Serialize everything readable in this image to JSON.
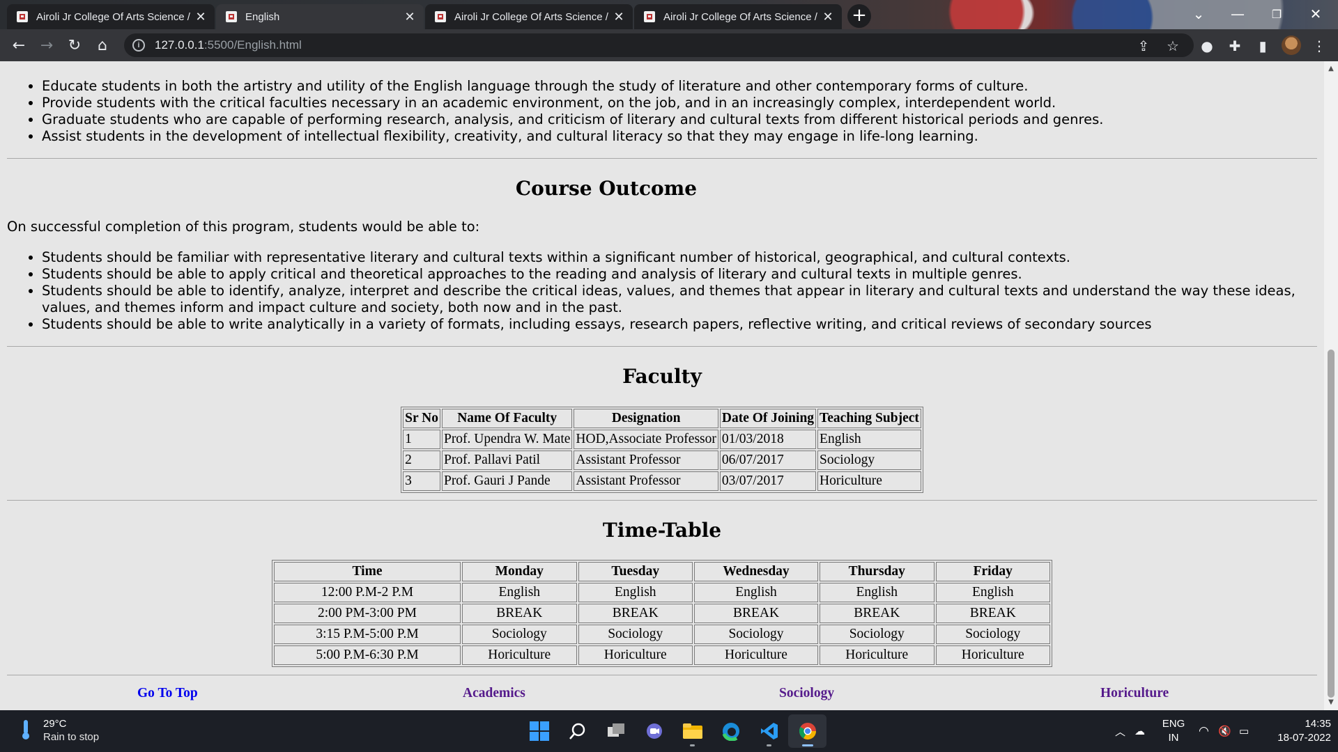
{
  "browser": {
    "tabs": [
      {
        "title": "Airoli Jr College Of Arts Science /",
        "active": false
      },
      {
        "title": "English",
        "active": true
      },
      {
        "title": "Airoli Jr College Of Arts Science /",
        "active": false
      },
      {
        "title": "Airoli Jr College Of Arts Science /",
        "active": false
      }
    ],
    "address": {
      "host": "127.0.0.1",
      "path": ":5500/English.html"
    },
    "close_glyph": "✕",
    "new_tab_glyph": "+"
  },
  "objectives": [
    "Educate students in both the artistry and utility of the English language through the study of literature and other contemporary forms of culture.",
    "Provide students with the critical faculties necessary in an academic environment, on the job, and in an increasingly complex, interdependent world.",
    "Graduate students who are capable of performing research, analysis, and criticism of literary and cultural texts from different historical periods and genres.",
    "Assist students in the development of intellectual flexibility, creativity, and cultural literacy so that they may engage in life-long learning."
  ],
  "course_outcome": {
    "heading": "Course Outcome",
    "intro": "On successful completion of this program, students would be able to:",
    "items": [
      "Students should be familiar with representative literary and cultural texts within a significant number of historical, geographical, and cultural contexts.",
      "Students should be able to apply critical and theoretical approaches to the reading and analysis of literary and cultural texts in multiple genres.",
      "Students should be able to identify, analyze, interpret and describe the critical ideas, values, and themes that appear in literary and cultural texts and understand the way these ideas, values, and themes inform and impact culture and society, both now and in the past.",
      "Students should be able to write analytically in a variety of formats, including essays, research papers, reflective writing, and critical reviews of secondary sources"
    ]
  },
  "faculty": {
    "heading": "Faculty",
    "columns": [
      "Sr No",
      "Name Of Faculty",
      "Designation",
      "Date Of Joining",
      "Teaching Subject"
    ],
    "rows": [
      [
        "1",
        "Prof. Upendra W. Mate",
        "HOD,Associate Professor",
        "01/03/2018",
        "English"
      ],
      [
        "2",
        "Prof. Pallavi Patil",
        "Assistant Professor",
        "06/07/2017",
        "Sociology"
      ],
      [
        "3",
        "Prof. Gauri J Pande",
        "Assistant Professor",
        "03/07/2017",
        "Horiculture"
      ]
    ]
  },
  "timetable": {
    "heading": "Time-Table",
    "columns": [
      "Time",
      "Monday",
      "Tuesday",
      "Wednesday",
      "Thursday",
      "Friday"
    ],
    "rows": [
      [
        "12:00 P.M-2 P.M",
        "English",
        "English",
        "English",
        "English",
        "English"
      ],
      [
        "2:00 PM-3:00 PM",
        "BREAK",
        "BREAK",
        "BREAK",
        "BREAK",
        "BREAK"
      ],
      [
        "3:15 P.M-5:00 P.M",
        "Sociology",
        "Sociology",
        "Sociology",
        "Sociology",
        "Sociology"
      ],
      [
        "5:00 P.M-6:30 P.M",
        "Horiculture",
        "Horiculture",
        "Horiculture",
        "Horiculture",
        "Horiculture"
      ]
    ]
  },
  "footer_links": {
    "go_to_top": "Go To Top",
    "academics": "Academics",
    "sociology": "Sociology",
    "horiculture": "Horiculture"
  },
  "colors": {
    "link": "#0000ee",
    "visited": "#551a8b",
    "page_bg": "#e6e6e6"
  },
  "taskbar": {
    "weather_temp": "29°C",
    "weather_text": "Rain to stop",
    "lang_line1": "ENG",
    "lang_line2": "IN",
    "time": "14:35",
    "date": "18-07-2022",
    "apps": [
      "windows-start-icon",
      "search-icon",
      "task-view-icon",
      "chat-icon",
      "file-explorer-icon",
      "edge-icon",
      "vscode-icon",
      "chrome-icon"
    ]
  }
}
